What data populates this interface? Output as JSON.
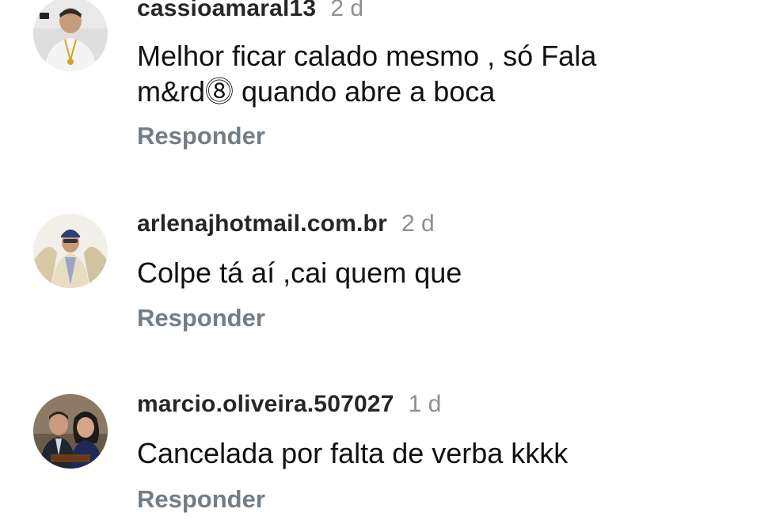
{
  "comments": [
    {
      "username": "cassioamaral13",
      "time": "2 d",
      "text_lines": [
        "Melhor ficar calado mesmo , só Fala",
        "m&rd⓼ quando abre a boca"
      ],
      "reply_label": "Responder",
      "avatar_icon": "user-avatar-photo"
    },
    {
      "username": "arlenajhotmail.com.br",
      "time": "2 d",
      "text_lines": [
        "Colpe tá aí ,cai quem que"
      ],
      "reply_label": "Responder",
      "avatar_icon": "user-avatar-photo"
    },
    {
      "username": "marcio.oliveira.507027",
      "time": "1 d",
      "text_lines": [
        "Cancelada por falta de verba kkkk"
      ],
      "reply_label": "Responder",
      "avatar_icon": "user-avatar-photo"
    }
  ]
}
